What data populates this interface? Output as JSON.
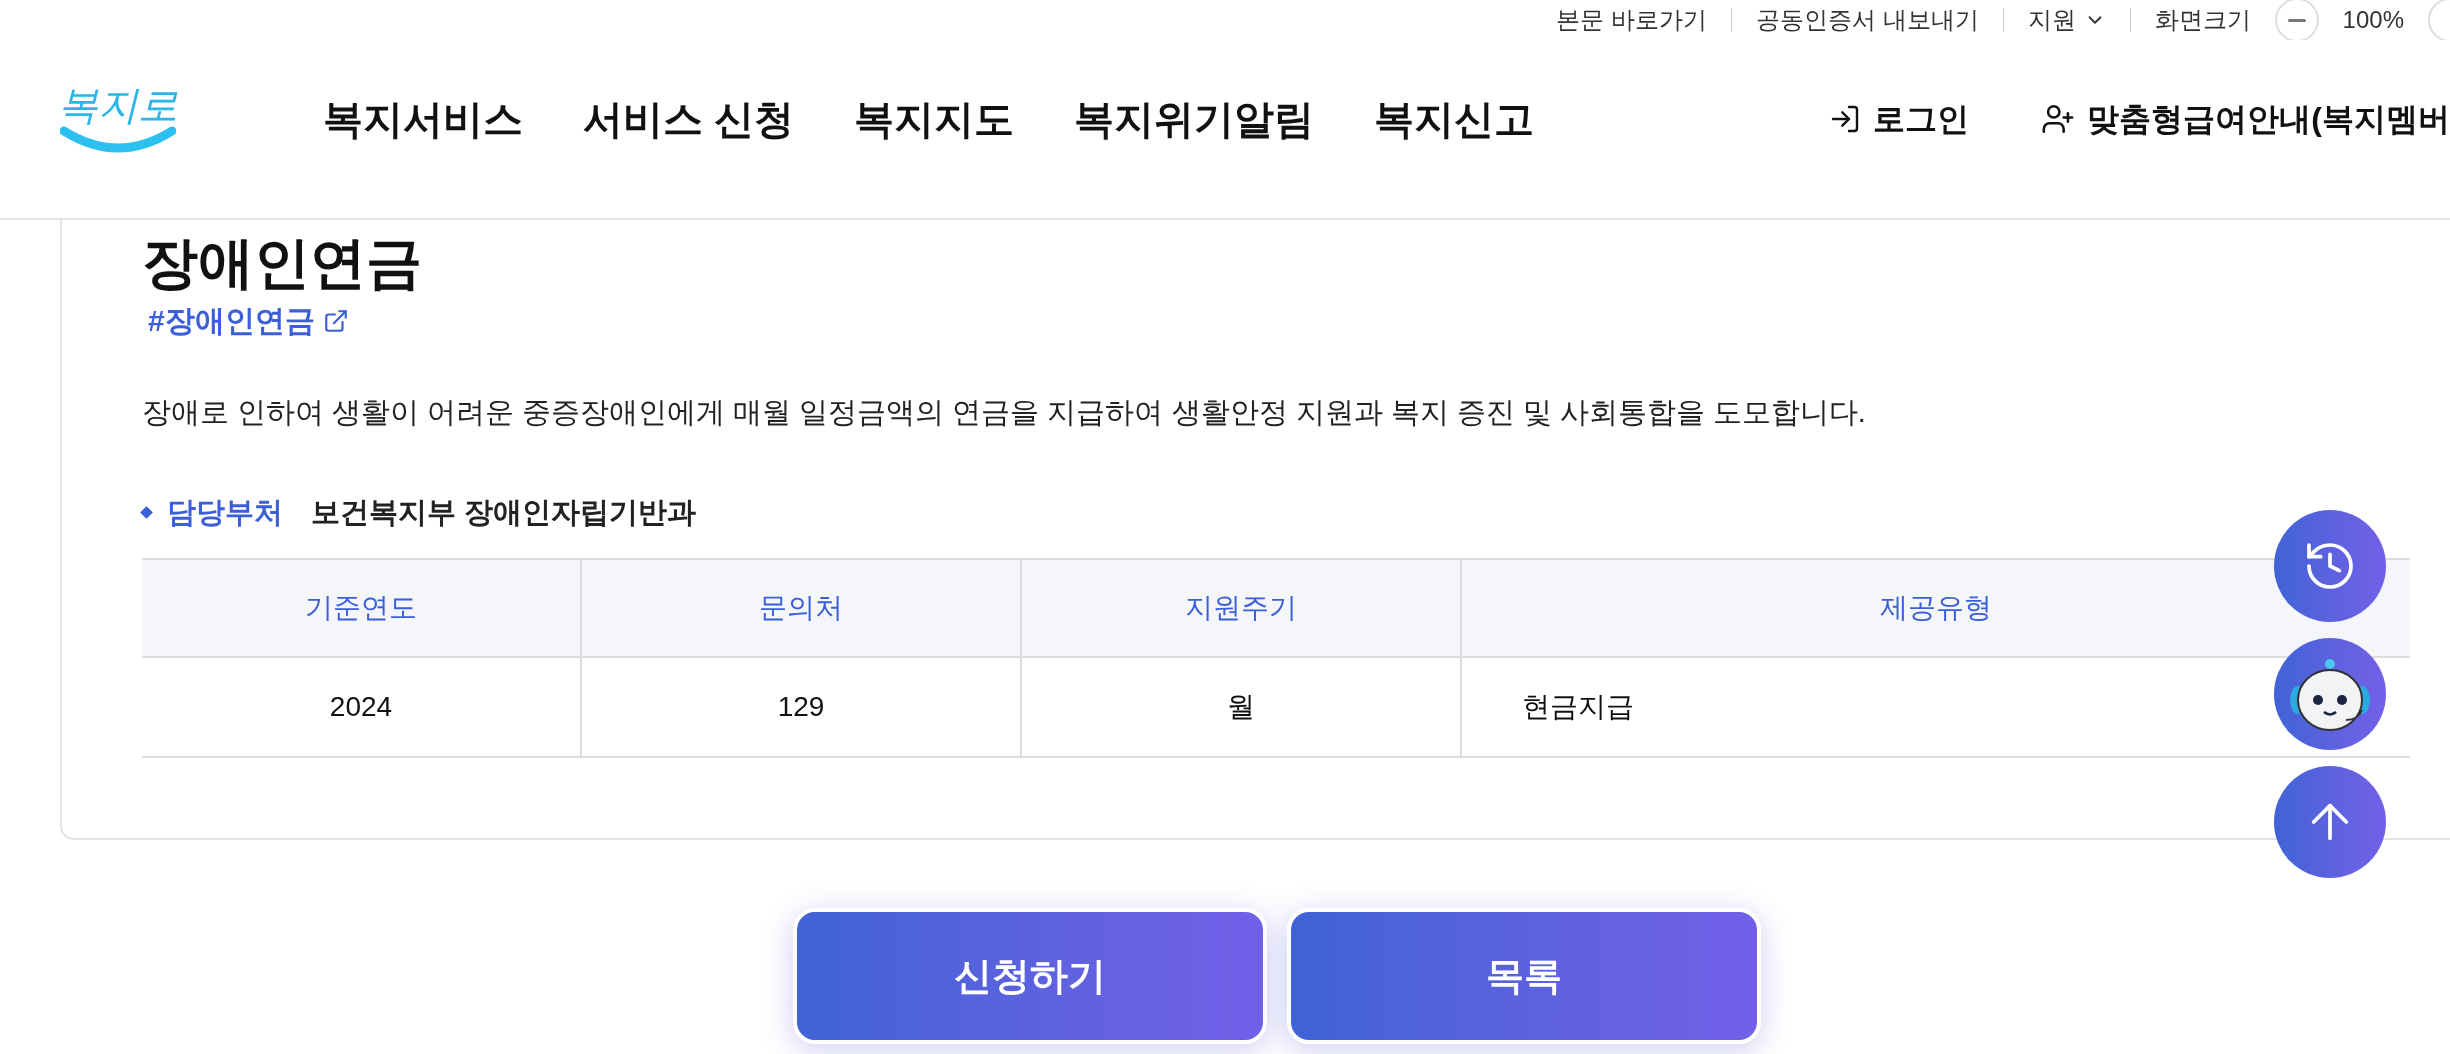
{
  "utility_bar": {
    "links": [
      "본문 바로가기",
      "공동인증서 내보내기"
    ],
    "language": "지원",
    "zoom_label": "화면크기",
    "zoom_value": "100%"
  },
  "header": {
    "logo": "복지로",
    "nav": [
      "복지서비스",
      "서비스 신청",
      "복지지도",
      "복지위기알림",
      "복지신고"
    ],
    "login": "로그인",
    "membership": "맞춤형급여안내(복지멤버"
  },
  "service": {
    "title": "장애인연금",
    "tag": "#장애인연금",
    "description": "장애로 인하여 생활이 어려운 중증장애인에게 매월 일정금액의 연금을 지급하여 생활안정 지원과 복지 증진 및 사회통합을 도모합니다.",
    "department_label": "담당부처",
    "department": "보건복지부 장애인자립기반과"
  },
  "table": {
    "columns": [
      "기준연도",
      "문의처",
      "지원주기",
      "제공유형"
    ],
    "rows": [
      [
        "2024",
        "129",
        "월",
        "현금지급"
      ]
    ]
  },
  "buttons": [
    "신청하기",
    "목록"
  ]
}
